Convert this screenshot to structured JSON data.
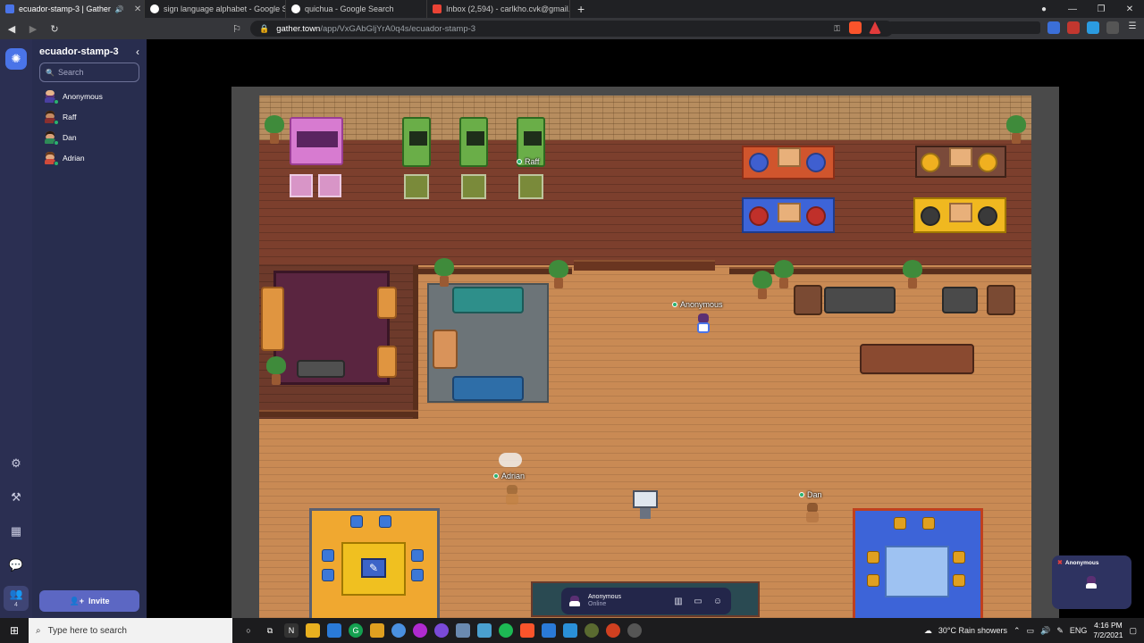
{
  "browser": {
    "tabs": [
      {
        "title": "ecuador-stamp-3 | Gather",
        "favicon_color": "#4a74e8",
        "active": true,
        "icon": "speaker-icon"
      },
      {
        "title": "sign language alphabet - Google Sear",
        "favicon_color": "#ffffff",
        "active": false
      },
      {
        "title": "quichua - Google Search",
        "favicon_color": "#ffffff",
        "active": false
      },
      {
        "title": "Inbox (2,594) - carlkho.cvk@gmail.com",
        "favicon_color": "#ea4335",
        "active": false
      }
    ],
    "new_tab": "+",
    "url_domain": "gather.town",
    "url_path": "/app/VxGAbGljYrA0q4s/ecuador-stamp-3"
  },
  "sidebar": {
    "space_name": "ecuador-stamp-3",
    "collapse": "‹",
    "search_placeholder": "Search",
    "members": [
      {
        "name": "Anonymous",
        "hair": "#5b2f73",
        "shirt": "#4a3fa0"
      },
      {
        "name": "Raff",
        "hair": "#3b2414",
        "shirt": "#8a2f2f"
      },
      {
        "name": "Dan",
        "hair": "#2b1a10",
        "shirt": "#2e8b57"
      },
      {
        "name": "Adrian",
        "hair": "#6a3a1a",
        "shirt": "#d04a3a"
      }
    ],
    "invite_label": "Invite",
    "people_count": "4"
  },
  "game": {
    "players": [
      {
        "name": "Anonymous"
      },
      {
        "name": "Raff"
      },
      {
        "name": "Adrian"
      },
      {
        "name": "Dan"
      }
    ],
    "bottom_bar": {
      "name": "Anonymous",
      "status": "Online"
    },
    "video_tile_name": "Anonymous"
  },
  "taskbar": {
    "search_placeholder": "Type here to search",
    "weather": "30°C  Rain showers",
    "lang": "ENG",
    "time": "4:16 PM",
    "date": "7/2/2021"
  }
}
